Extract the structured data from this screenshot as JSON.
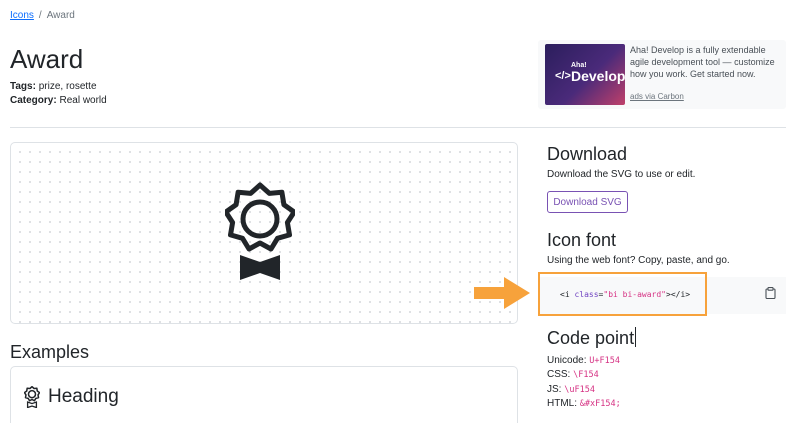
{
  "breadcrumb": {
    "link": "Icons",
    "separator": "/",
    "current": "Award"
  },
  "icon": {
    "title": "Award",
    "tags_label": "Tags:",
    "tags": "prize, rosette",
    "category_label": "Category:",
    "category": "Real world"
  },
  "ad": {
    "logo_small": "Aha!",
    "logo_code": "</>",
    "logo_big": "Develop",
    "text": "Aha! Develop is a fully extendable agile development tool — customize how you work. Get started now.",
    "link": "ads via Carbon"
  },
  "download": {
    "title": "Download",
    "desc": "Download the SVG to use or edit.",
    "button": "Download SVG"
  },
  "icon_font": {
    "title": "Icon font",
    "desc": "Using the web font? Copy, paste, and go.",
    "code_open": "<i ",
    "code_attr": "class",
    "code_eq": "=",
    "code_str": "\"bi bi-award\"",
    "code_close": "></i>"
  },
  "code_point": {
    "title": "Code point",
    "rows": [
      {
        "label": "Unicode:",
        "value": "U+F154"
      },
      {
        "label": "CSS:",
        "value": "\\F154"
      },
      {
        "label": "JS:",
        "value": "\\uF154"
      },
      {
        "label": "HTML:",
        "value": "&#xF154;"
      }
    ]
  },
  "examples": {
    "title": "Examples",
    "heading": "Heading"
  },
  "colors": {
    "accent": "#7952b3",
    "link": "#0d6efd",
    "code": "#d63384",
    "highlight": "#f7a23b"
  }
}
